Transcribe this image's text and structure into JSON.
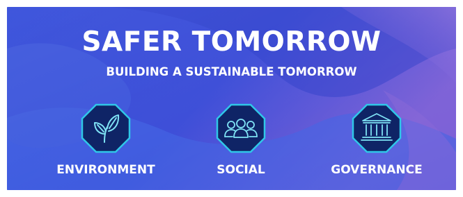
{
  "headline": {
    "title": "SAFER TOMORROW",
    "subtitle": "BUILDING A SUSTAINABLE TOMORROW"
  },
  "pillars": [
    {
      "label": "ENVIRONMENT",
      "icon": "leaf-icon"
    },
    {
      "label": "SOCIAL",
      "icon": "people-icon"
    },
    {
      "label": "GOVERNANCE",
      "icon": "courthouse-icon"
    }
  ],
  "colors": {
    "background_start": "#2a3fd6",
    "background_end": "#7a5fd8",
    "badge_fill": "#0f2466",
    "badge_border": "#2fc7e8",
    "icon_stroke": "#7fe3f5",
    "text": "#ffffff"
  }
}
